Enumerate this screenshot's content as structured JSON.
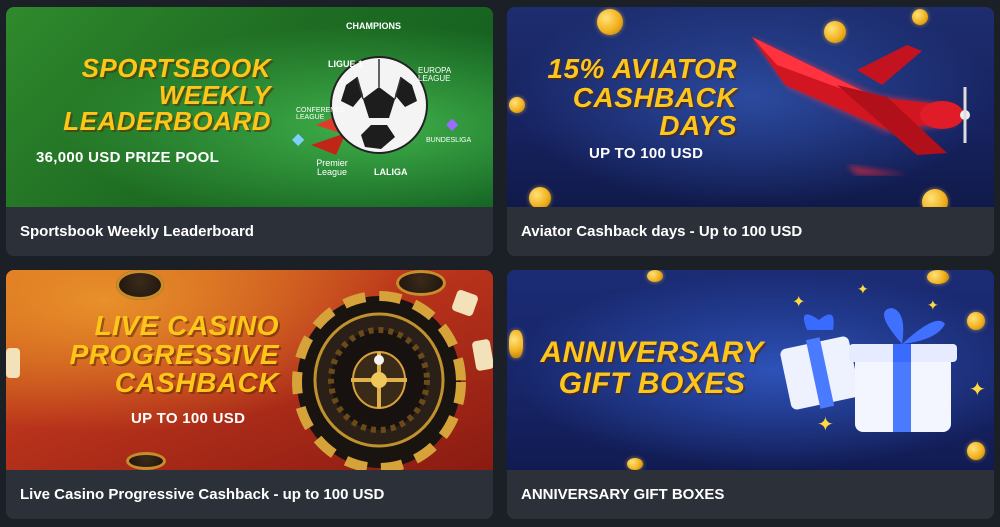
{
  "cards": [
    {
      "banner": {
        "headline_lines": [
          "SPORTSBOOK",
          "WEEKLY",
          "LEADERBOARD"
        ],
        "subtitle": "36,000 USD PRIZE POOL"
      },
      "caption": "Sportsbook Weekly Leaderboard",
      "art_icon": "soccer-ball-icon",
      "logos": [
        "CHAMPIONS",
        "LIGUE 1",
        "CONFERENCE LEAGUE",
        "EUROPA LEAGUE",
        "BUNDESLIGA",
        "Premier League",
        "LALIGA"
      ]
    },
    {
      "banner": {
        "headline_lines": [
          "15% AVIATOR",
          "CASHBACK",
          "DAYS"
        ],
        "subtitle": "UP TO 100 USD"
      },
      "caption": "Aviator Cashback days - Up to 100 USD",
      "art_icon": "red-airplane-icon"
    },
    {
      "banner": {
        "headline_lines": [
          "LIVE CASINO",
          "PROGRESSIVE",
          "CASHBACK"
        ],
        "subtitle": "UP TO 100 USD"
      },
      "caption": "Live Casino Progressive Cashback - up to 100 USD",
      "art_icon": "roulette-wheel-icon"
    },
    {
      "banner": {
        "headline_lines": [
          "ANNIVERSARY",
          "GIFT BOXES"
        ]
      },
      "caption": "ANNIVERSARY GIFT BOXES",
      "art_icon": "gift-boxes-icon"
    }
  ],
  "colors": {
    "headline": "#ffc61a",
    "caption_bg": "#2b3039",
    "page_bg": "#1b1f26"
  }
}
